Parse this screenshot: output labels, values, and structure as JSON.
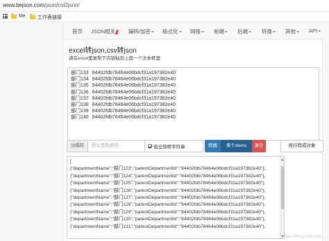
{
  "browser": {
    "address_host": "www.bejson.com",
    "address_path": "/json/col2json/",
    "bookmarks": [
      "Me",
      "工作表链接"
    ]
  },
  "nav": {
    "items": [
      {
        "label": "首页",
        "caret": false,
        "hot": false
      },
      {
        "label": "JSON相关",
        "caret": false,
        "hot": true
      },
      {
        "label": "编码/加密",
        "caret": true,
        "hot": false
      },
      {
        "label": "格式化",
        "caret": true,
        "hot": false
      },
      {
        "label": "网络",
        "caret": true,
        "hot": false
      },
      {
        "label": "前端",
        "caret": true,
        "hot": false
      },
      {
        "label": "后端",
        "caret": true,
        "hot": false
      },
      {
        "label": "转换",
        "caret": true,
        "hot": false
      },
      {
        "label": "其他",
        "caret": true,
        "hot": false
      },
      {
        "label": "API",
        "caret": true,
        "hot": false
      }
    ]
  },
  "page": {
    "title": "excel转json,csv转json",
    "subtitle": "请在excel里复制下内容粘到上面一个文本框里"
  },
  "input": {
    "lines": [
      [
        "部门133",
        "84402fdb78464e06bdcf31a197382e40"
      ],
      [
        "部门134",
        "84402fdb78464e06bdcf31a197382e40"
      ],
      [
        "部门135",
        "84402fdb78464e06bdcf31a197382e40"
      ],
      [
        "部门136",
        "84402fdb78464e06bdcf31a197382e40"
      ],
      [
        "部门137",
        "84402fdb78464e06bdcf31a197382e40"
      ],
      [
        "部门138",
        "84402fdb78464e06bdcf31a197382e40"
      ],
      [
        "部门139",
        "84402fdb78464e06bdcf31a197382e40"
      ],
      [
        "部门140",
        "84402fdb78464e06bdcf31a197382e40"
      ]
    ]
  },
  "toolbar": {
    "separator_label": "分隔符",
    "separator_placeholder": "默认是制表符",
    "checkbox_label": "值全部用字符串",
    "checkbox_checked": true,
    "convert_label": "转换",
    "demo_label": "来个demo",
    "clear_label": "清空",
    "lines_label": "按行转成对象"
  },
  "output": {
    "lines": [
      "[",
      "{\"departmentName\":\"部门123\",\"parentDepartmentId\":\"84402fdb78464e06bdcf31a197382e40\"},",
      "{\"departmentName\":\"部门124\",\"parentDepartmentId\":\"84402fdb78464e06bdcf31a197382e40\"},",
      "{\"departmentName\":\"部门125\",\"parentDepartmentId\":\"84402fdb78464e06bdcf31a197382e40\"},",
      "{\"departmentName\":\"部门126\",\"parentDepartmentId\":\"84402fdb78464e06bdcf31a197382e40\"},",
      "{\"departmentName\":\"部门127\",\"parentDepartmentId\":\"84402fdb78464e06bdcf31a197382e40\"},",
      "{\"departmentName\":\"部门128\",\"parentDepartmentId\":\"84402fdb78464e06bdcf31a197382e40\"},",
      "{\"departmentName\":\"部门129\",\"parentDepartmentId\":\"84402fdb78464e06bdcf31a197382e40\"},",
      "{\"departmentName\":\"部门130\",\"parentDepartmentId\":\"84402fdb78464e06bdcf31a197382e40\"},",
      "{\"departmentName\":\"部门131\",\"parentDepartmentId\":\"84402fdb78464e06bdcf31a197382e40\"},"
    ]
  },
  "watermark": "https://blog.csdn.net/..."
}
